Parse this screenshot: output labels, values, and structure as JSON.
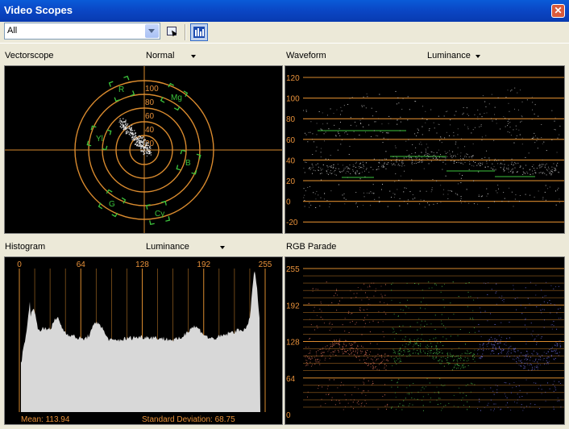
{
  "window": {
    "title": "Video Scopes",
    "close_glyph": "✕"
  },
  "toolbar": {
    "source": "All",
    "buttons": [
      "picker-icon",
      "scopes-layout-icon"
    ]
  },
  "colors": {
    "graticule": "#d98a2e",
    "target": "#3cc43c",
    "label": "#e8913a"
  },
  "vectorscope": {
    "title": "Vectorscope",
    "mode": "Normal",
    "rings": [
      "20",
      "40",
      "60",
      "80",
      "100"
    ],
    "targets": [
      "R",
      "Mg",
      "B",
      "Cy",
      "G",
      "Yl"
    ]
  },
  "waveform": {
    "title": "Waveform",
    "mode": "Luminance",
    "ticks": [
      "120",
      "100",
      "80",
      "60",
      "40",
      "20",
      "0",
      "-20"
    ]
  },
  "histogram": {
    "title": "Histogram",
    "mode": "Luminance",
    "ticks": [
      "0",
      "64",
      "128",
      "192",
      "255"
    ],
    "mean": "Mean: 113.94",
    "std": "Standard Deviation: 68.75"
  },
  "parade": {
    "title": "RGB Parade",
    "ticks": [
      "255",
      "192",
      "128",
      "64",
      "0"
    ]
  }
}
